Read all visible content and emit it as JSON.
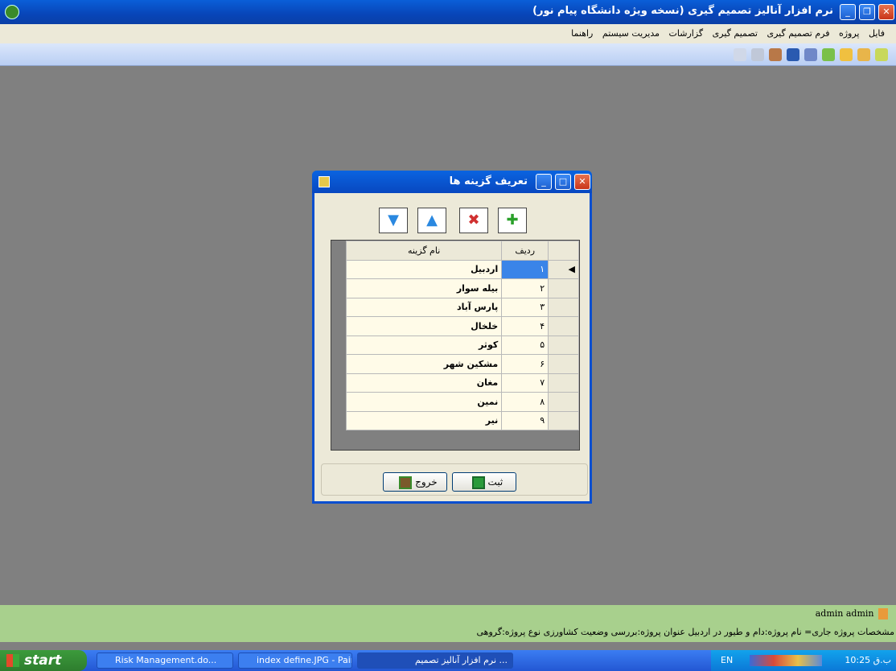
{
  "window": {
    "title": "نرم افزار آنالیز تصمیم گیری (نسخه ویژه دانشگاه پیام نور)",
    "menu": [
      "فایل",
      "پروژه",
      "فرم تصمیم گیری",
      "تصمیم گیری",
      "گزارشات",
      "مدیریت سیستم",
      "راهنما"
    ]
  },
  "dialog": {
    "title": "تعریف گزینه ها",
    "grid": {
      "headers": {
        "row_num": "ردیف",
        "name": "نام گزینه"
      },
      "rows": [
        {
          "num": "۱",
          "name": "اردبیل"
        },
        {
          "num": "۲",
          "name": "بیله سوار"
        },
        {
          "num": "۳",
          "name": "پارس آباد"
        },
        {
          "num": "۴",
          "name": "خلخال"
        },
        {
          "num": "۵",
          "name": "کوثر"
        },
        {
          "num": "۶",
          "name": "مشکین شهر"
        },
        {
          "num": "۷",
          "name": "مغان"
        },
        {
          "num": "۸",
          "name": "نمین"
        },
        {
          "num": "۹",
          "name": "نیر"
        }
      ]
    },
    "save_label": "ثبت",
    "exit_label": "خروج"
  },
  "status": {
    "user": "admin admin",
    "project_info": "مشخصات پروژه جاری= نام پروژه:دام و طیور در اردبیل  عنوان پروژه:بررسی وضعیت کشاورزی  نوع پروژه:گروهی"
  },
  "taskbar": {
    "start": "start",
    "tasks": [
      "Risk Management.do...",
      "index define.JPG - Paint",
      "... نرم افزار آنالیز تصمیم"
    ],
    "lang": "EN",
    "clock": "10:25 ب.ق"
  }
}
